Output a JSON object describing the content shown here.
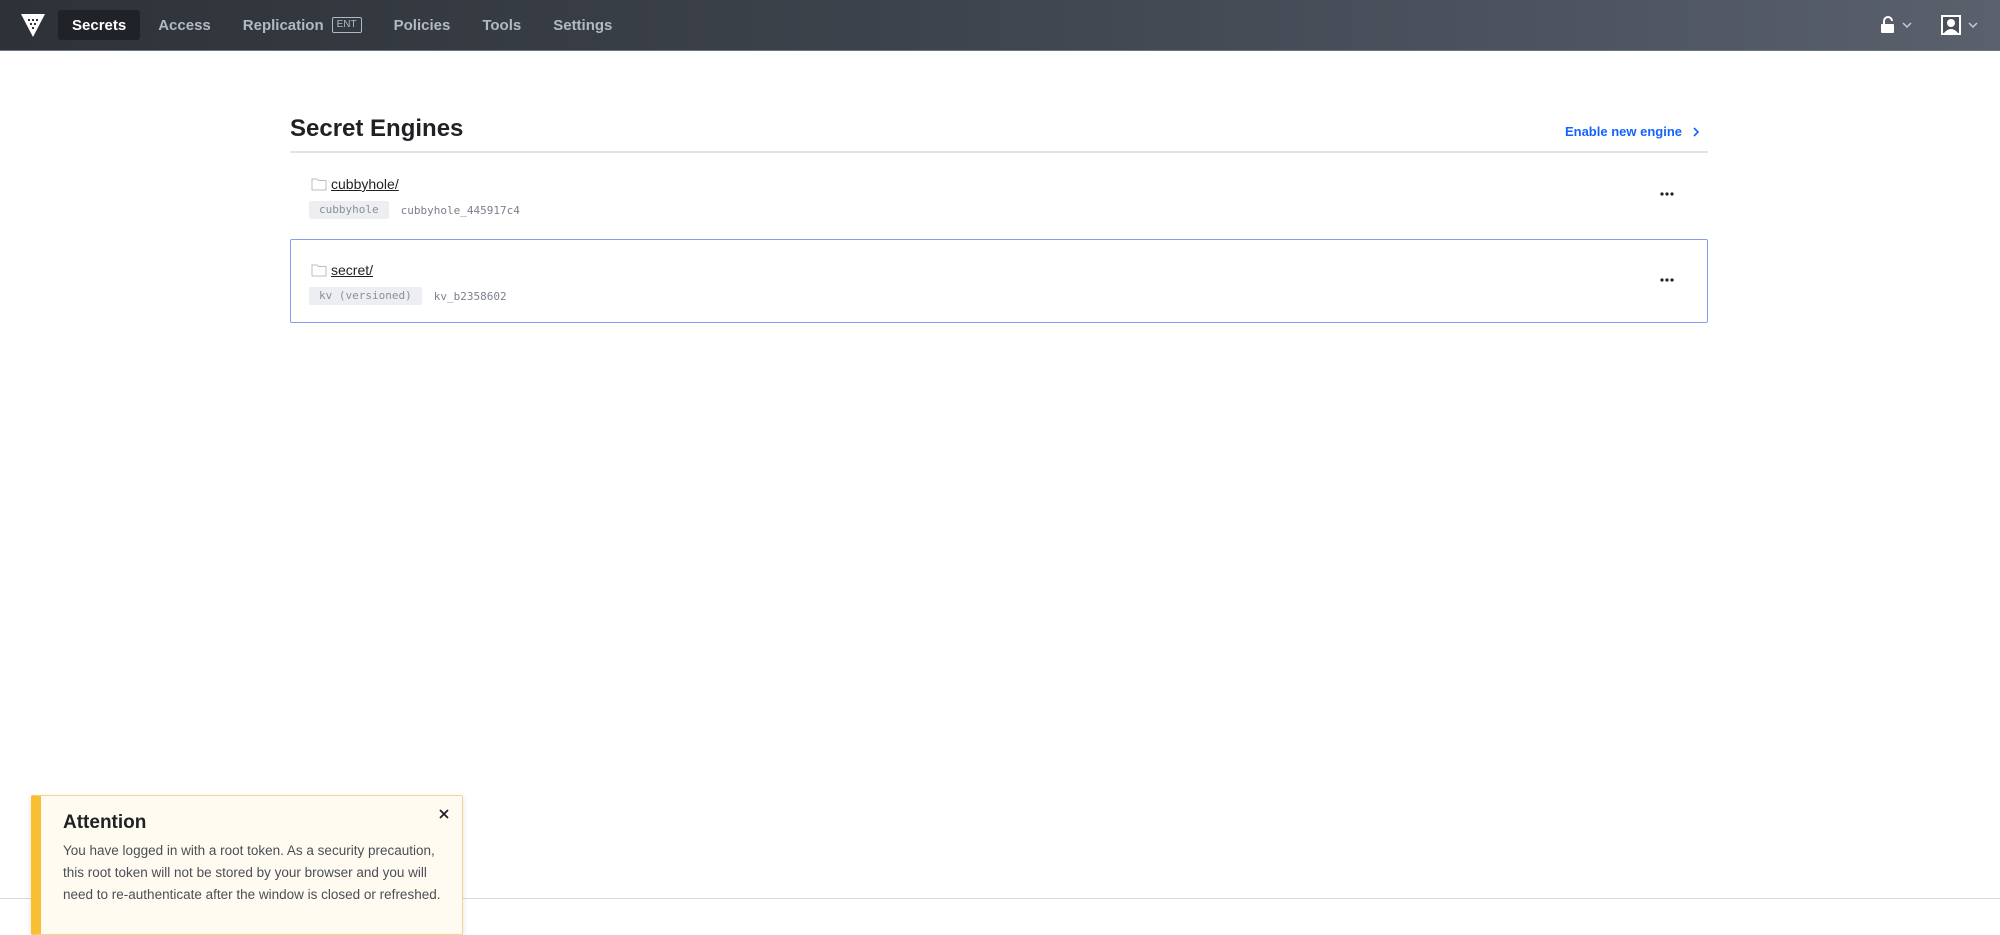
{
  "nav": {
    "items": [
      {
        "label": "Secrets",
        "active": true
      },
      {
        "label": "Access",
        "active": false
      },
      {
        "label": "Replication",
        "active": false,
        "badge": "ENT"
      },
      {
        "label": "Policies",
        "active": false
      },
      {
        "label": "Tools",
        "active": false
      },
      {
        "label": "Settings",
        "active": false
      }
    ],
    "logo_icon": "vault-logo-icon",
    "status_icon": "unlocked-icon",
    "user_icon": "user-avatar-icon"
  },
  "page": {
    "title": "Secret Engines",
    "enable_link": "Enable new engine"
  },
  "engines": [
    {
      "path": "cubbyhole/",
      "type": "cubbyhole",
      "accessor": "cubbyhole_445917c4",
      "focused": false
    },
    {
      "path": "secret/",
      "type": "kv (versioned)",
      "accessor": "kv_b2358602",
      "focused": true
    }
  ],
  "flash": {
    "title": "Attention",
    "message": "You have logged in with a root token. As a security precaution, this root token will not be stored by your browser and you will need to re-authenticate after the window is closed or refreshed."
  },
  "colors": {
    "accent": "#1563ff",
    "warning": "#f8bf33",
    "focus_border": "#8c9bf0"
  }
}
